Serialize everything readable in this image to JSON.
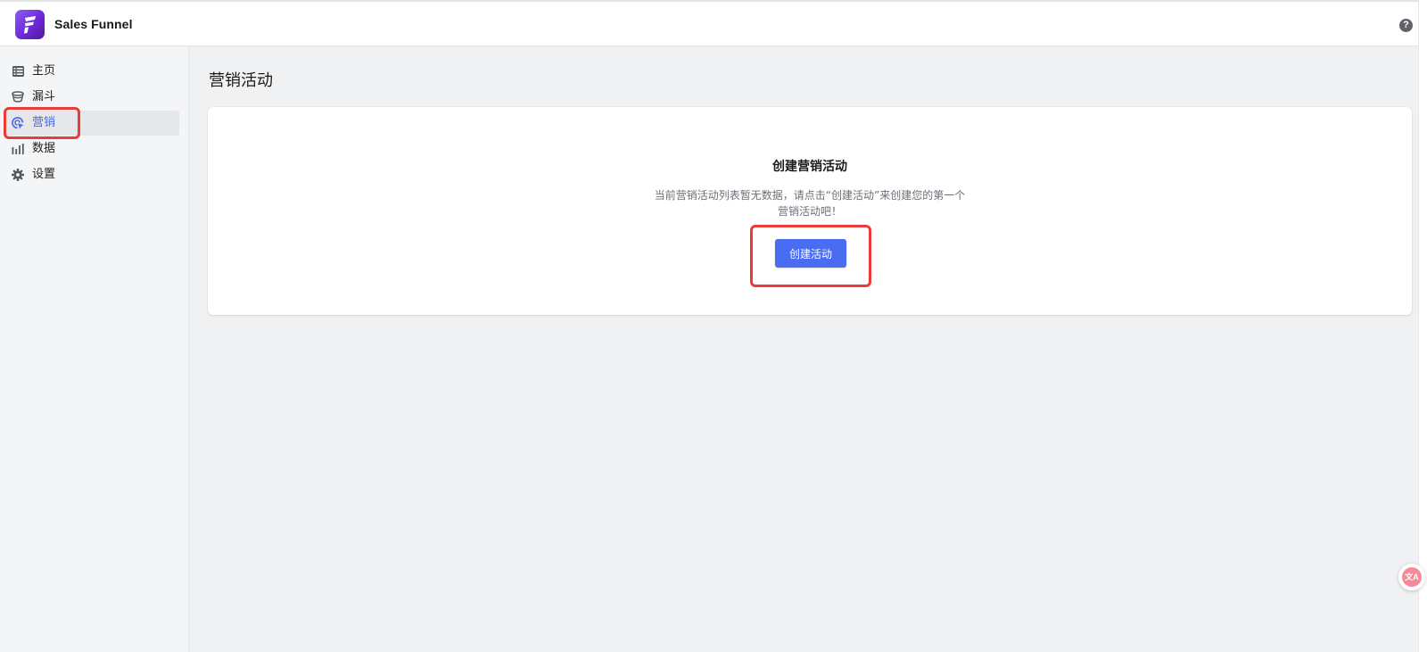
{
  "header": {
    "app_title": "Sales Funnel",
    "help_icon_text": "?"
  },
  "sidebar": {
    "items": [
      {
        "label": "主页",
        "icon": "list-icon"
      },
      {
        "label": "漏斗",
        "icon": "funnel-icon"
      },
      {
        "label": "营销",
        "icon": "target-cursor-icon",
        "active": true
      },
      {
        "label": "数据",
        "icon": "bar-chart-icon"
      },
      {
        "label": "设置",
        "icon": "gear-icon"
      }
    ]
  },
  "main": {
    "page_title": "营销活动",
    "empty_state": {
      "title": "创建营销活动",
      "description": "当前营销活动列表暂无数据，请点击“创建活动”来创建您的第一个营销活动吧！",
      "button_label": "创建活动"
    }
  },
  "colors": {
    "accent": "#4a6cf0",
    "active_label": "#4a68e6",
    "highlight": "#ea3a3a",
    "logo": "#7c3aed"
  },
  "floating": {
    "translate_text": "文A"
  }
}
